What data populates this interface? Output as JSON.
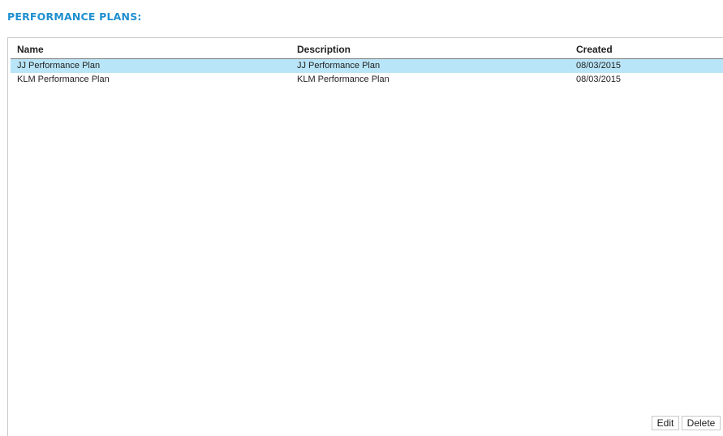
{
  "page": {
    "title": "PERFORMANCE PLANS:"
  },
  "grid": {
    "columns": [
      "Name",
      "Description",
      "Created"
    ],
    "rows": [
      {
        "name": "JJ Performance Plan",
        "description": "JJ Performance Plan",
        "created": "08/03/2015",
        "selected": true
      },
      {
        "name": "KLM Performance Plan",
        "description": "KLM Performance Plan",
        "created": "08/03/2015",
        "selected": false
      }
    ]
  },
  "actions": {
    "edit_label": "Edit",
    "delete_label": "Delete"
  },
  "colors": {
    "title": "#1e8fd0",
    "selected_row": "#b8e5f7"
  }
}
